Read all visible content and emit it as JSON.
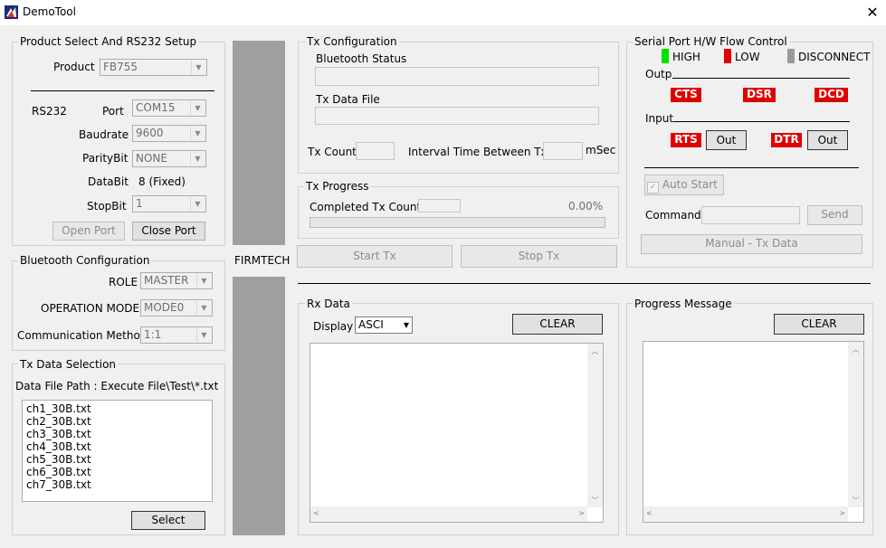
{
  "window": {
    "title": "DemoTool",
    "close_symbol": "✕"
  },
  "product_setup": {
    "title": "Product Select And RS232 Setup",
    "product_label": "Product",
    "product_value": "FB755",
    "rs232_label": "RS232",
    "port_label": "Port",
    "port_value": "COM15",
    "baudrate_label": "Baudrate",
    "baudrate_value": "9600",
    "parity_label": "ParityBit",
    "parity_value": "NONE",
    "databit_label": "DataBit",
    "databit_value": "8 (Fixed)",
    "stopbit_label": "StopBit",
    "stopbit_value": "1",
    "open_port": "Open Port",
    "close_port": "Close Port"
  },
  "bt_config": {
    "title": "Bluetooth Configuration",
    "role_label": "ROLE",
    "role_value": "MASTER",
    "opmode_label": "OPERATION MODE",
    "opmode_value": "MODE0",
    "comm_label": "Communication Method",
    "comm_value": "1:1"
  },
  "tx_data_sel": {
    "title": "Tx Data Selection",
    "path_label": "Data File Path : Execute File\\Test\\*.txt",
    "files": [
      "ch1_30B.txt",
      "ch2_30B.txt",
      "ch3_30B.txt",
      "ch4_30B.txt",
      "ch5_30B.txt",
      "ch6_30B.txt",
      "ch7_30B.txt"
    ],
    "select_button": "Select"
  },
  "brand": {
    "label": "FIRMTECH"
  },
  "tx_config": {
    "title": "Tx Configuration",
    "bt_status_label": "Bluetooth Status",
    "tx_file_label": "Tx Data File",
    "tx_count_label": "Tx Count",
    "interval_label": "Interval Time Between Tx",
    "msec_label": "mSec"
  },
  "tx_progress": {
    "title": "Tx Progress",
    "completed_label": "Completed Tx Count",
    "percent": "0.00%",
    "progress_fraction": 0
  },
  "tx_buttons": {
    "start": "Start Tx",
    "stop": "Stop Tx"
  },
  "flow_control": {
    "title": "Serial Port H/W Flow Control",
    "legend": [
      {
        "label": "HIGH",
        "color": "#00e000"
      },
      {
        "label": "LOW",
        "color": "#e00000"
      },
      {
        "label": "DISCONNECT",
        "color": "#9a9a9a"
      }
    ],
    "output_label": "Output",
    "input_label": "Input",
    "outputs": [
      "CTS",
      "DSR",
      "DCD"
    ],
    "inputs": [
      "RTS",
      "DTR"
    ],
    "out_button": "Out",
    "auto_start": "Auto Start",
    "command_label": "Command",
    "send_button": "Send",
    "manual_button": "Manual - Tx Data"
  },
  "rx_data": {
    "title": "Rx Data",
    "display_label": "Display",
    "display_value": "ASCI",
    "clear_button": "CLEAR"
  },
  "progress_msg": {
    "title": "Progress Message",
    "clear_button": "CLEAR"
  }
}
